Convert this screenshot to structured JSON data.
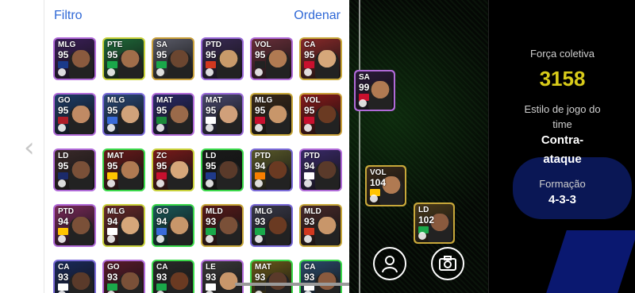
{
  "header": {
    "filter_label": "Filtro",
    "sort_label": "Ordenar"
  },
  "back_icon": "chevron-left-icon",
  "cards": [
    {
      "pos": "MLG",
      "ovr": "95",
      "border": "#b06ad8",
      "bg": "#3c1f5a",
      "flag": "#1b3a8a",
      "face": "#8a5a3e"
    },
    {
      "pos": "PTE",
      "ovr": "95",
      "border": "#c8d13a",
      "bg": "#1f6b3a",
      "flag": "#1aa84a",
      "face": "#a06e4a"
    },
    {
      "pos": "SA",
      "ovr": "95",
      "border": "#c9a03a",
      "bg": "#5a5b68",
      "flag": "#1aa84a",
      "face": "#6b4630"
    },
    {
      "pos": "PTD",
      "ovr": "95",
      "border": "#9a6ad8",
      "bg": "#3a2a55",
      "flag": "#d1381f",
      "face": "#c89a6a"
    },
    {
      "pos": "VOL",
      "ovr": "95",
      "border": "#b06ad8",
      "bg": "#6a2f3a",
      "flag": "#222222",
      "face": "#b07a52"
    },
    {
      "pos": "CA",
      "ovr": "95",
      "border": "#c8a83a",
      "bg": "#8a2a2a",
      "flag": "#c8102e",
      "face": "#d6a77a"
    },
    {
      "pos": "GO",
      "ovr": "95",
      "border": "#b06ad8",
      "bg": "#1e3d6a",
      "flag": "#ae1c28",
      "face": "#c08a64"
    },
    {
      "pos": "MLG",
      "ovr": "95",
      "border": "#7a6ad8",
      "bg": "#2a4a7a",
      "flag": "#3a6bd8",
      "face": "#d0a27a"
    },
    {
      "pos": "MAT",
      "ovr": "95",
      "border": "#b06ad8",
      "bg": "#2a2a6a",
      "flag": "#1a8a3a",
      "face": "#9a6a4a"
    },
    {
      "pos": "MAT",
      "ovr": "95",
      "border": "#9a6ad8",
      "bg": "#4a4a70",
      "flag": "#ffffff",
      "face": "#d0a07a"
    },
    {
      "pos": "MLG",
      "ovr": "95",
      "border": "#c8a83a",
      "bg": "#3a2a1a",
      "flag": "#c8102e",
      "face": "#c8966a"
    },
    {
      "pos": "VOL",
      "ovr": "95",
      "border": "#c9a03a",
      "bg": "#8a1a1a",
      "flag": "#c8102e",
      "face": "#6a3a22"
    },
    {
      "pos": "LD",
      "ovr": "95",
      "border": "#b06ad8",
      "bg": "#3a2a2a",
      "flag": "#1b2a6a",
      "face": "#7a5038"
    },
    {
      "pos": "MAT",
      "ovr": "95",
      "border": "#3ad84a",
      "bg": "#6a1a1a",
      "flag": "#ffc400",
      "face": "#b07a52"
    },
    {
      "pos": "ZC",
      "ovr": "95",
      "border": "#c8d13a",
      "bg": "#7a1a1a",
      "flag": "#c8102e",
      "face": "#d6a77a"
    },
    {
      "pos": "LD",
      "ovr": "95",
      "border": "#3ad84a",
      "bg": "#1a1a1a",
      "flag": "#1f3a8a",
      "face": "#5a3a2a"
    },
    {
      "pos": "PTD",
      "ovr": "94",
      "border": "#7a6ad8",
      "bg": "#5a5a2a",
      "flag": "#f77f00",
      "face": "#6a3a22"
    },
    {
      "pos": "PTD",
      "ovr": "94",
      "border": "#b06ad8",
      "bg": "#3a2a6a",
      "flag": "#ffffff",
      "face": "#5a3a2a"
    },
    {
      "pos": "PTD",
      "ovr": "94",
      "border": "#b06ad8",
      "bg": "#7a2a5a",
      "flag": "#ffc400",
      "face": "#7a5038"
    },
    {
      "pos": "MLG",
      "ovr": "94",
      "border": "#c8d13a",
      "bg": "#6a2a2a",
      "flag": "#ffffff",
      "face": "#d6a77a"
    },
    {
      "pos": "GO",
      "ovr": "94",
      "border": "#3ad84a",
      "bg": "#1a5a5a",
      "flag": "#3a6bd8",
      "face": "#c8966a"
    },
    {
      "pos": "MLD",
      "ovr": "93",
      "border": "#c8a83a",
      "bg": "#5a1a1a",
      "flag": "#1aa84a",
      "face": "#7a5038"
    },
    {
      "pos": "MLG",
      "ovr": "93",
      "border": "#7a6ad8",
      "bg": "#3a3a4a",
      "flag": "#1aa84a",
      "face": "#6a3a22"
    },
    {
      "pos": "MLD",
      "ovr": "93",
      "border": "#c8a83a",
      "bg": "#4a2a2a",
      "flag": "#d1381f",
      "face": "#c8966a"
    },
    {
      "pos": "CA",
      "ovr": "93",
      "border": "#7a6ad8",
      "bg": "#1a2a5a",
      "flag": "#ffffff",
      "face": "#5a3a2a"
    },
    {
      "pos": "GO",
      "ovr": "93",
      "border": "#b06ad8",
      "bg": "#5a1a2a",
      "flag": "#1aa84a",
      "face": "#7a5038"
    },
    {
      "pos": "CA",
      "ovr": "93",
      "border": "#3ad84a",
      "bg": "#2a2a2a",
      "flag": "#1aa84a",
      "face": "#6a3a22"
    },
    {
      "pos": "LE",
      "ovr": "93",
      "border": "#b06ad8",
      "bg": "#3a3a3a",
      "flag": "#ffffff",
      "face": "#c8966a"
    },
    {
      "pos": "MAT",
      "ovr": "93",
      "border": "#3ad84a",
      "bg": "#6a5a1a",
      "flag": "#222222",
      "face": "#5a3a2a"
    },
    {
      "pos": "CA",
      "ovr": "93",
      "border": "#3ad84a",
      "bg": "#2a4a6a",
      "flag": "#ffffff",
      "face": "#8a5a3e"
    }
  ],
  "pitch_cards": [
    {
      "pos": "SA",
      "ovr": "99",
      "border": "#b06ad8",
      "bg": "#2a1a3a",
      "flag": "#c8102e",
      "face": "#b07a52"
    },
    {
      "pos": "VOL",
      "ovr": "104",
      "border": "#c8a83a",
      "bg": "#3a2a1a",
      "flag": "#ffc400",
      "face": "#b07a52"
    },
    {
      "pos": "LD",
      "ovr": "102",
      "border": "#c8a83a",
      "bg": "#4a3a1a",
      "flag": "#1aa84a",
      "face": "#8a5a3e"
    }
  ],
  "pitch_buttons": {
    "profile_icon": "person-icon",
    "camera_icon": "camera-icon"
  },
  "team_info": {
    "power_label": "Força coletiva",
    "power_value": "3158",
    "style_label_line1": "Estilo de jogo do",
    "style_label_line2": "time",
    "style_value_line1": "Contra-",
    "style_value_line2": "ataque",
    "formation_label": "Formação",
    "formation_value": "4-3-3"
  },
  "colors": {
    "accent": "#2f68d6",
    "power": "#d8cb1a"
  }
}
